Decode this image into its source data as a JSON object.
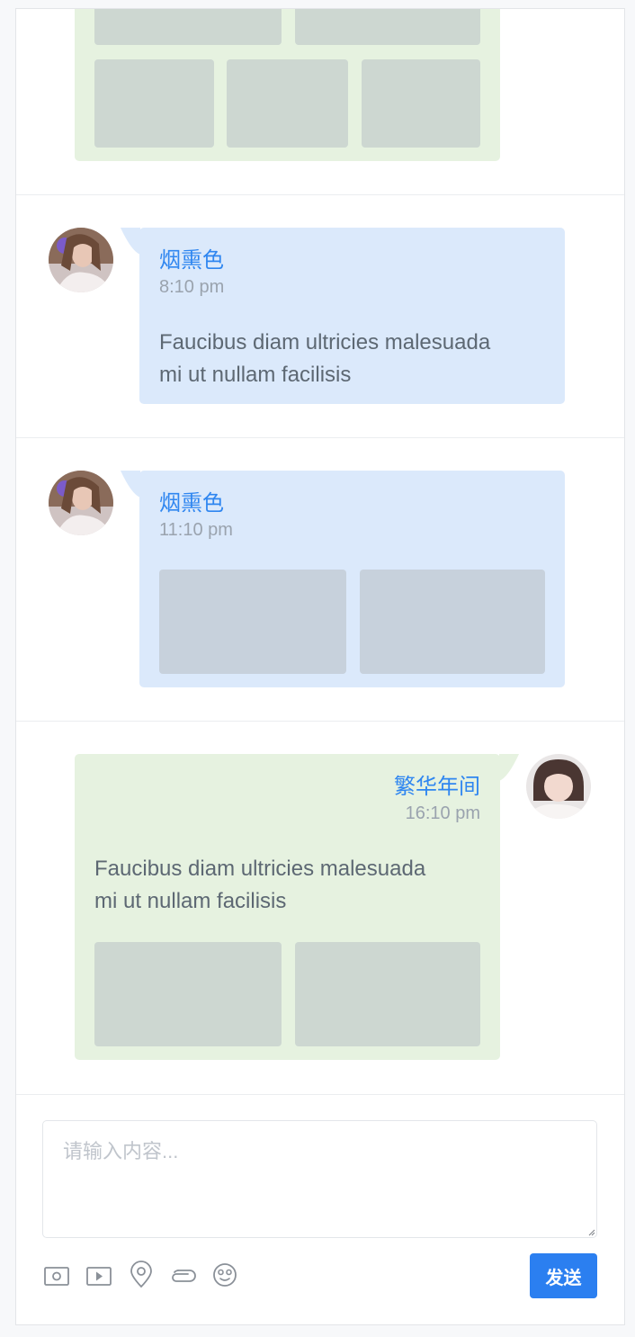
{
  "messages": [
    {
      "type": "outgoing",
      "images": 5
    },
    {
      "type": "incoming",
      "name": "烟熏色",
      "time": "8:10 pm",
      "text_line1": "Faucibus diam ultricies malesuada",
      "text_line2": "mi ut nullam facilisis"
    },
    {
      "type": "incoming",
      "name": "烟熏色",
      "time": "11:10 pm",
      "images": 2
    },
    {
      "type": "outgoing",
      "name": "繁华年间",
      "time": "16:10 pm",
      "text_line1": "Faucibus diam ultricies malesuada",
      "text_line2": "mi ut nullam facilisis",
      "images": 2
    }
  ],
  "composer": {
    "placeholder": "请输入内容...",
    "send_label": "发送",
    "tools": [
      "image-icon",
      "video-icon",
      "location-icon",
      "attachment-icon",
      "emoji-icon"
    ]
  },
  "colors": {
    "accent": "#2b7ff0",
    "name": "#2f86f0",
    "incoming_bubble": "#dbe9fb",
    "outgoing_bubble": "#e6f2e0"
  }
}
